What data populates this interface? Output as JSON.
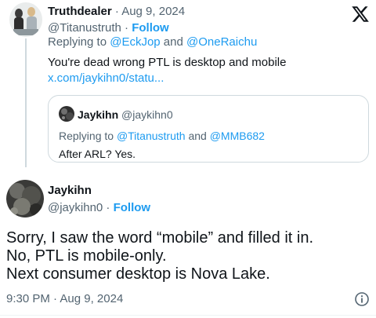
{
  "parent": {
    "author_name": "Truthdealer",
    "separator": " · ",
    "date": "Aug 9, 2024",
    "handle": "@Titanustruth",
    "follow_sep": " · ",
    "follow_label": "Follow",
    "replying_prefix": "Replying to ",
    "replying_user1": "@EckJop",
    "replying_and": " and ",
    "replying_user2": "@OneRaichu",
    "body_text": "You're dead wrong PTL is desktop and mobile",
    "link_text": "x.com/jaykihn0/statu..."
  },
  "quote": {
    "author_name": "Jaykihn",
    "handle": "@jaykihn0",
    "replying_prefix": "Replying to ",
    "replying_user1": "@Titanustruth",
    "replying_and": " and ",
    "replying_user2": "@MMB682",
    "body_text": "After ARL? Yes."
  },
  "main": {
    "author_name": "Jaykihn",
    "handle": "@jaykihn0",
    "follow_sep": " · ",
    "follow_label": "Follow",
    "body_lines": [
      "Sorry, I saw the word “mobile” and filled it in.",
      "No, PTL is mobile-only.",
      "Next consumer desktop is Nova Lake."
    ],
    "time": "9:30 PM",
    "time_sep": " · ",
    "date": "Aug 9, 2024"
  },
  "icons": {
    "platform_logo": "x-logo-icon",
    "info": "info-icon"
  },
  "colors": {
    "text": "#0f1419",
    "muted": "#536471",
    "link": "#1d9bf0",
    "border": "#cfd9de"
  }
}
